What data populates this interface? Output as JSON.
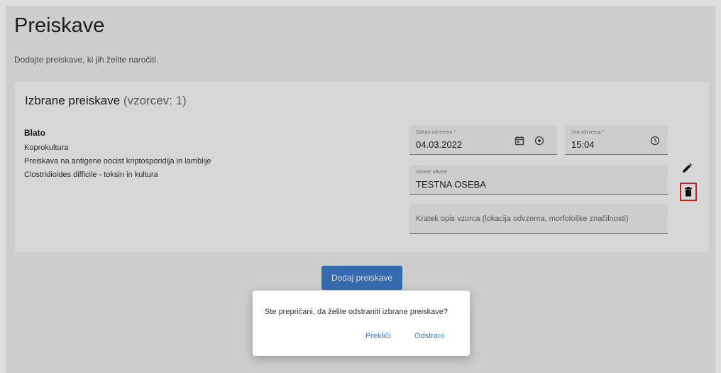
{
  "header": {
    "title": "Preiskave",
    "subtitle": "Dodajte preiskave, ki jih želite naročiti."
  },
  "card": {
    "title": "Izbrane preiskave",
    "count": "(vzorcev: 1)",
    "group": {
      "name": "Blato",
      "tests": [
        "Koprokultura",
        "Preiskava na antigene oocist kriptosporidija in lamblije",
        "Clostridioides difficile - toksin in kultura"
      ]
    },
    "fields": {
      "date": {
        "label": "Datum odvzema *",
        "value": "04.03.2022"
      },
      "time": {
        "label": "Ura odvzema *",
        "value": "15:04"
      },
      "sample": {
        "label": "Vzorec odvzel",
        "value": "TESTNA OSEBA"
      },
      "description": {
        "placeholder": "Kratek opis vzorca (lokacija odvzema, morfološke značilnosti)"
      }
    },
    "icons": [
      "pencil-icon",
      "trash-icon",
      "calendar-icon",
      "radio-icon",
      "clock-icon"
    ]
  },
  "add_button": "Dodaj preiskave",
  "dialog": {
    "message": "Ste prepričani, da želite odstraniti izbrane preiskave?",
    "cancel": "Prekliči",
    "confirm": "Odstrani"
  },
  "colors": {
    "accent": "#3d7bc8",
    "highlight_border": "#e0262a"
  }
}
